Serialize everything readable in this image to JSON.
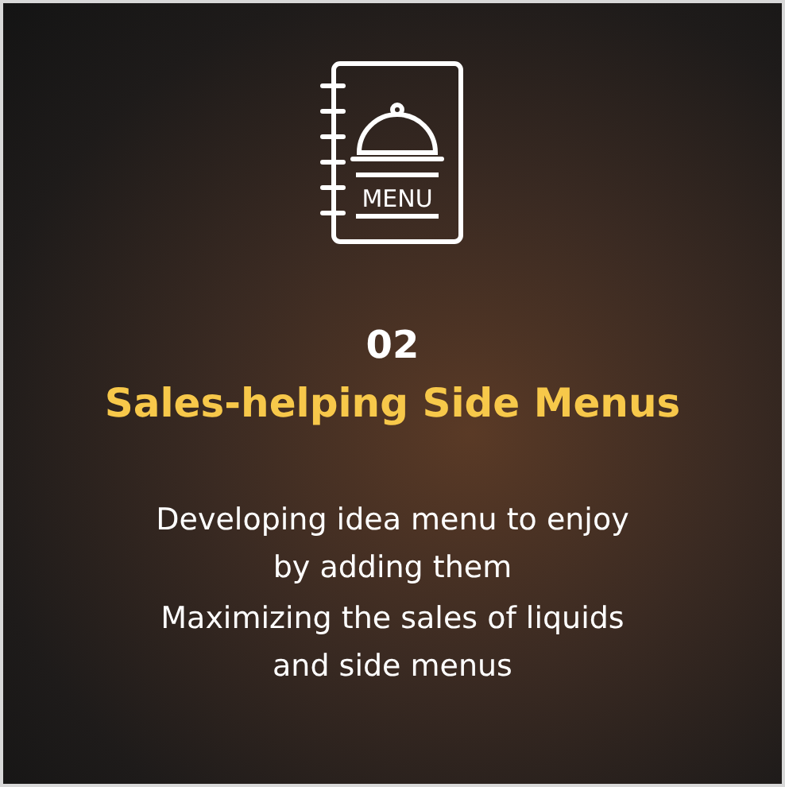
{
  "icon": {
    "label": "MENU"
  },
  "number": "02",
  "title": "Sales-helping Side Menus",
  "description": [
    "Developing idea menu to enjoy",
    "by adding them",
    "Maximizing the sales of liquids",
    "and side menus"
  ]
}
